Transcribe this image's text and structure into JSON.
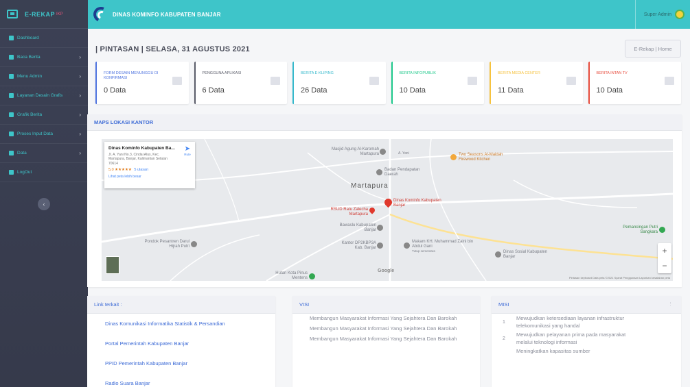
{
  "sidebar": {
    "brand": "E-REKAP",
    "brand_sup": "IKP",
    "items": [
      {
        "label": "Dashboard",
        "chevron": ""
      },
      {
        "label": "Baca Berita",
        "chevron": "›"
      },
      {
        "label": "Menu Admin",
        "chevron": "›"
      },
      {
        "label": "Layanan Desain Grafis",
        "chevron": "›"
      },
      {
        "label": "Grafik Berita",
        "chevron": "›"
      },
      {
        "label": "Proses Input Data",
        "chevron": "›"
      },
      {
        "label": "Data",
        "chevron": "›"
      },
      {
        "label": "LogOut",
        "chevron": ""
      }
    ],
    "toggle": "‹"
  },
  "topbar": {
    "org": "DINAS KOMINFO KABUPATEN BANJAR",
    "user": "Super Admin"
  },
  "heading": "| PINTASAN | SELASA, 31 AGUSTUS 2021",
  "breadcrumb": "E-Rekap | Home",
  "cards": [
    {
      "label": "FORM DESAIN MENUNGGU DI KONFIRMASI",
      "value": "0 Data",
      "color": "#4e73df"
    },
    {
      "label": "PENGGUNA APLIKASI",
      "value": "6 Data",
      "color": "#5a5c69"
    },
    {
      "label": "BERITA E-KLIPING",
      "value": "26 Data",
      "color": "#36b9cc"
    },
    {
      "label": "BERITA INFOPUBLIK",
      "value": "10 Data",
      "color": "#1cc88a"
    },
    {
      "label": "BERITA MEDIA CENTER",
      "value": "11 Data",
      "color": "#f6c23e"
    },
    {
      "label": "BERITA INTAN TV",
      "value": "10 Data",
      "color": "#e74a3b"
    }
  ],
  "map": {
    "title": "MAPS LOKASI KANTOR",
    "info": {
      "title": "Dinas Kominfo Kabupaten Ba...",
      "address": "Jl. A. Yani No.3, Cindai Alus, Kec. Martapura, Banjar, Kalimantan Selatan 70614",
      "rating": "5,0 ★★★★★",
      "reviews": "5 ulasan",
      "link": "Lihat peta lebih besar",
      "route": "Rute"
    },
    "labels": {
      "masjid": "Masjid Agung Al-Karomah Martapura",
      "two_seasons": "Two Seasons Al-Maidah Firewood Kitchen",
      "bapenda": "Badan Pendapatan Daerah",
      "city": "Martapura",
      "kominfo": "Dinas Kominfo Kabupaten Banjar",
      "rsud": "RSUD Ratu Zalecha Martapura",
      "bawaslu": "Bawaslu Kabupaten Banjar",
      "pondok": "Pondok Pesantren Darul Hijrah Putri",
      "kantor": "Kantor DP2KBP3A Kab. Banjar",
      "makam": "Makam KH. Muhammad Zaini bin Abdul Gani",
      "makam_sub": "Tutup sementara",
      "dinsos": "Dinas Sosial Kabupaten Banjar",
      "pemancingan": "Pemancingan Putri Sangkara",
      "hutan": "Hutan Kota Pinus Mentens",
      "road": "A. Yani"
    },
    "google": "Google",
    "attribution": "Pintasan keyboard   Data peta ©2021   Syarat Penggunaan   Laporkan kesalahan peta",
    "zoom_in": "+",
    "zoom_out": "−"
  },
  "links_panel": {
    "title": "Link terkait :",
    "items": [
      "Dinas Komunikasi Informatika Statistik & Persandian",
      "Portal Pemerintah Kabupaten Banjar",
      "PPID Pemerintah Kabupaten Banjar",
      "Radio Suara Banjar"
    ]
  },
  "visi_panel": {
    "title": "VISI",
    "items": [
      "Membangun Masyarakat Informasi Yang Sejahtera Dan Barokah",
      "Membangun Masyarakat Informasi Yang Sejahtera Dan Barokah",
      "Membangun Masyarakat Informasi Yang Sejahtera Dan Barokah"
    ]
  },
  "misi_panel": {
    "title": "MISI",
    "dots": "⋮",
    "items": [
      {
        "num": "1",
        "text": "Mewujudkan ketersediaan layanan infrastruktur telekomunikasi yang handal"
      },
      {
        "num": "2",
        "text": "Mewujudkan pelayanan prima pada masyarakat melalui teknologi informasi"
      },
      {
        "num": "",
        "text": "Meningkatkan kapasitas sumber"
      }
    ]
  }
}
